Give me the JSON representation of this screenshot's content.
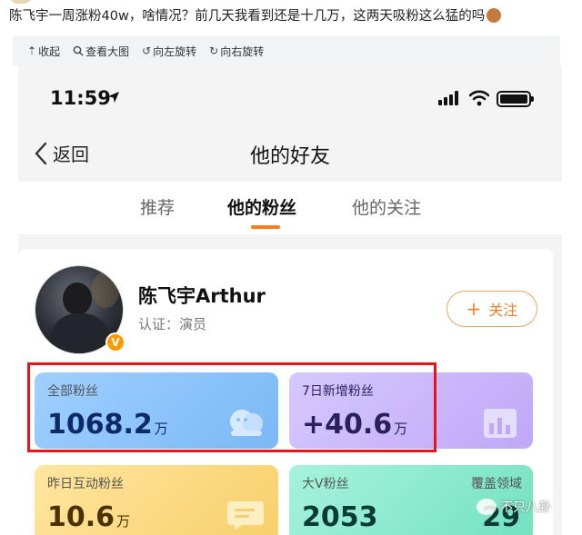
{
  "post": {
    "text": "陈飞宇一周涨粉40w，啥情况？前几天我看到还是十几万，这两天吸粉这么猛的吗"
  },
  "toolbar": {
    "collapse": "收起",
    "view_large": "查看大图",
    "rotate_left": "向左旋转",
    "rotate_right": "向右旋转"
  },
  "status_bar": {
    "time": "11:59"
  },
  "nav": {
    "back_label": "返回",
    "title": "他的好友"
  },
  "tabs": [
    {
      "label": "推荐"
    },
    {
      "label": "他的粉丝"
    },
    {
      "label": "他的关注"
    }
  ],
  "profile": {
    "name": "陈飞宇Arthur",
    "verification": "认证：演员",
    "badge": "V",
    "follow_label": "关注"
  },
  "stats": {
    "total_fans": {
      "label": "全部粉丝",
      "value": "1068.2",
      "unit": "万"
    },
    "new_7d": {
      "label": "7日新增粉丝",
      "value": "+40.6",
      "unit": "万"
    },
    "yesterday_interactive": {
      "label": "昨日互动粉丝",
      "value": "10.6",
      "unit": "万"
    },
    "big_v": {
      "label": "大V粉丝",
      "value": "2053",
      "coverage_label": "覆盖领域",
      "coverage_value": "29"
    }
  },
  "watermark": {
    "text": "不只八卦"
  },
  "colors": {
    "accent_orange": "#ff7a1a",
    "highlight_red": "#e8141b"
  }
}
